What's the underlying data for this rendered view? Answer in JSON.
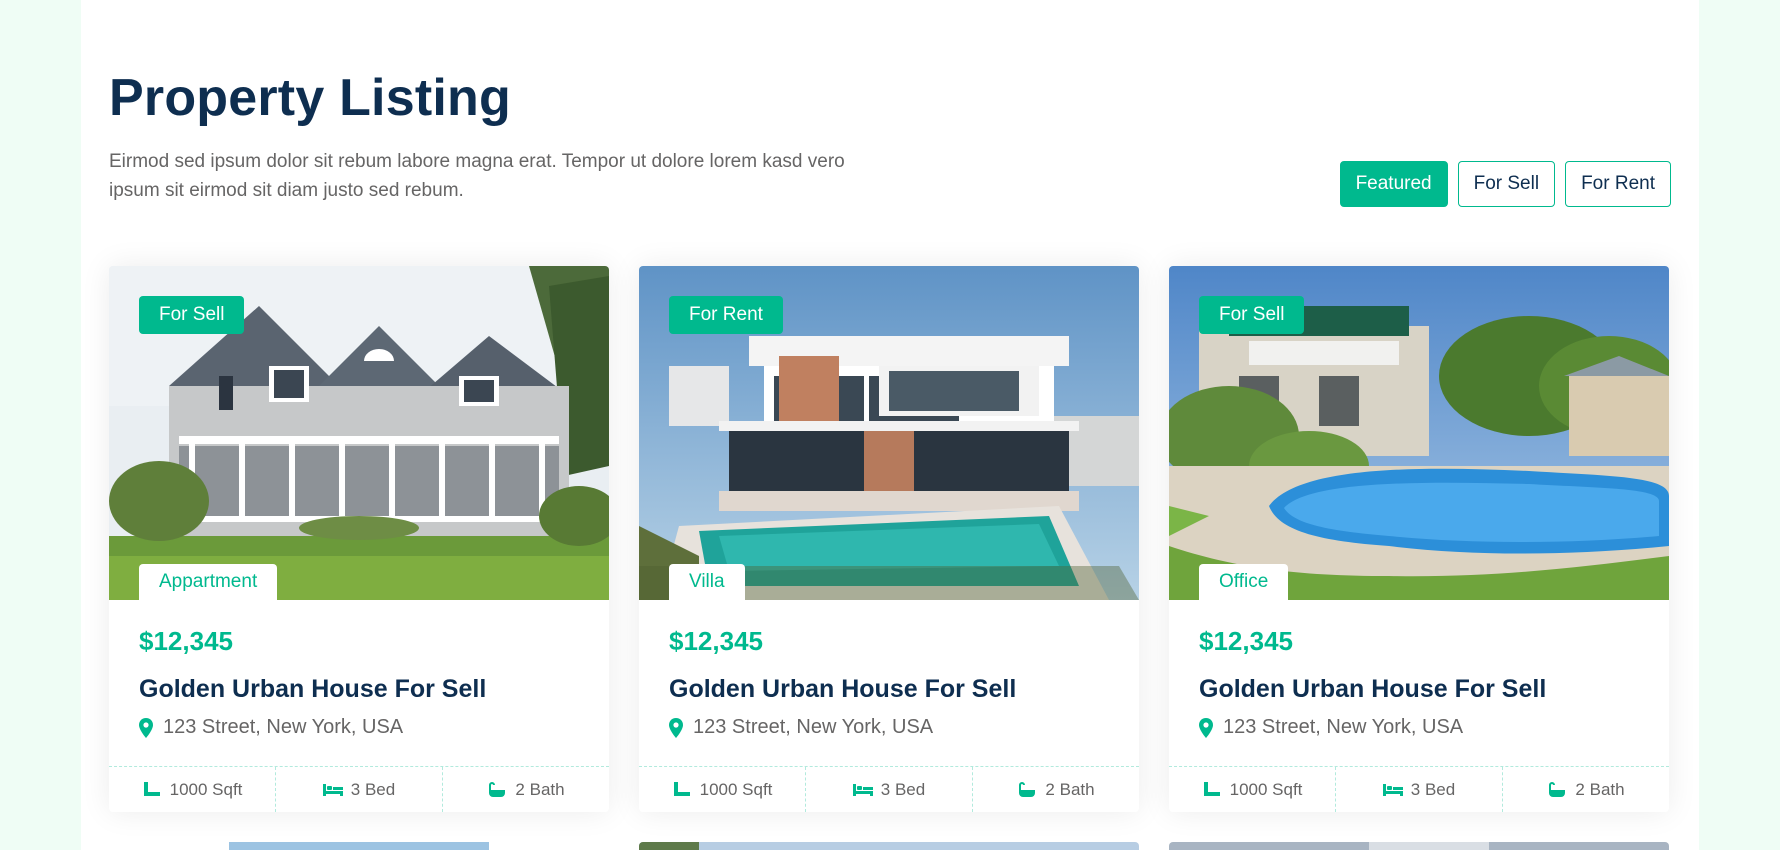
{
  "header": {
    "title": "Property Listing",
    "description": "Eirmod sed ipsum dolor sit rebum labore magna erat. Tempor ut dolore lorem kasd vero ipsum sit eirmod sit diam justo sed rebum."
  },
  "tabs": [
    {
      "label": "Featured",
      "active": true
    },
    {
      "label": "For Sell",
      "active": false
    },
    {
      "label": "For Rent",
      "active": false
    }
  ],
  "accent_color": "#00b98e",
  "heading_color": "#0e2e50",
  "properties": [
    {
      "status": "For Sell",
      "type": "Appartment",
      "price": "$12,345",
      "name": "Golden Urban House For Sell",
      "address": "123 Street, New York, USA",
      "area": "1000 Sqft",
      "beds": "3 Bed",
      "baths": "2 Bath",
      "image_icon": "house-photo"
    },
    {
      "status": "For Rent",
      "type": "Villa",
      "price": "$12,345",
      "name": "Golden Urban House For Sell",
      "address": "123 Street, New York, USA",
      "area": "1000 Sqft",
      "beds": "3 Bed",
      "baths": "2 Bath",
      "image_icon": "villa-photo"
    },
    {
      "status": "For Sell",
      "type": "Office",
      "price": "$12,345",
      "name": "Golden Urban House For Sell",
      "address": "123 Street, New York, USA",
      "area": "1000 Sqft",
      "beds": "3 Bed",
      "baths": "2 Bath",
      "image_icon": "pool-photo"
    }
  ]
}
